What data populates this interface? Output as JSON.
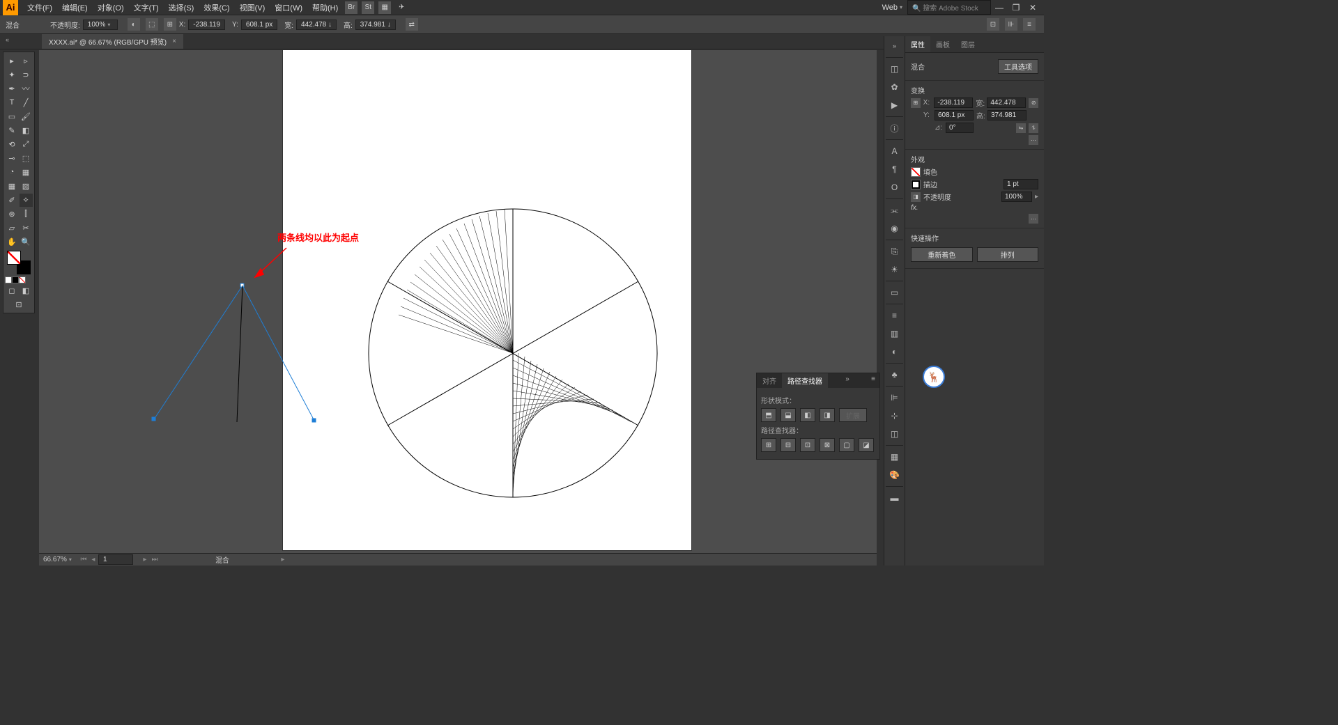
{
  "app": {
    "logo": "Ai"
  },
  "menu": {
    "items": [
      "文件(F)",
      "编辑(E)",
      "对象(O)",
      "文字(T)",
      "选择(S)",
      "效果(C)",
      "视图(V)",
      "窗口(W)",
      "帮助(H)"
    ],
    "workspace": "Web",
    "search_placeholder": "搜索 Adobe Stock"
  },
  "options": {
    "tool_label": "混合",
    "opacity_label": "不透明度:",
    "opacity_value": "100%",
    "x_label": "X:",
    "x_value": "-238.119",
    "y_label": "Y:",
    "y_value": "608.1 px",
    "w_label": "宽:",
    "w_value": "442.478 ↓",
    "h_label": "高:",
    "h_value": "374.981 ↓"
  },
  "tab": {
    "title": "XXXX.ai* @ 66.67% (RGB/GPU 预览)"
  },
  "annotation": {
    "text": "两条线均以此为起点"
  },
  "status": {
    "zoom": "66.67%",
    "page": "1",
    "tool": "混合"
  },
  "floatpanel": {
    "tabs": [
      "对齐",
      "路径查找器"
    ],
    "shape_mode": "形状模式：",
    "expand": "扩展",
    "pathfinders": "路径查找器："
  },
  "properties": {
    "tabs": [
      "属性",
      "画板",
      "图层"
    ],
    "section_blend": "混合",
    "tool_options": "工具选项",
    "section_transform": "变换",
    "x_label": "X:",
    "x_val": "-238.119",
    "y_label": "Y:",
    "y_val": "608.1 px",
    "w_label": "宽:",
    "w_val": "442.478",
    "h_label": "高:",
    "h_val": "374.981",
    "angle_label": "⊿:",
    "angle_val": "0°",
    "section_appearance": "外观",
    "fill_label": "填色",
    "stroke_label": "描边",
    "stroke_val": "1 pt",
    "opacity_label": "不透明度",
    "opacity_val": "100%",
    "fx_label": "fx.",
    "section_quick": "快速操作",
    "recolor": "重新着色",
    "arrange": "排列"
  }
}
